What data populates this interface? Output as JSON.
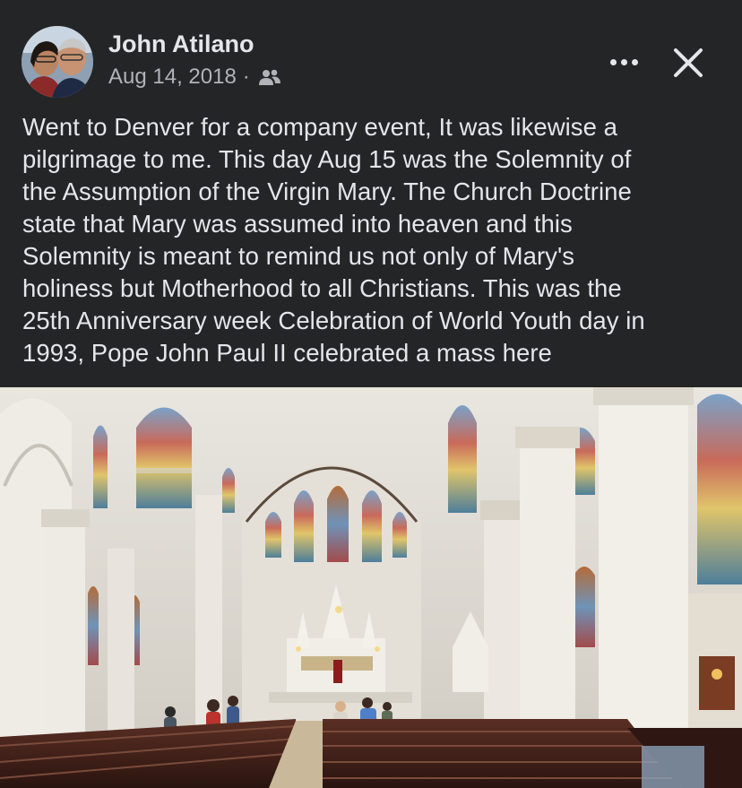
{
  "post": {
    "author": "John Atilano",
    "date": "Aug 14, 2018",
    "separator": "·",
    "audience_icon": "friends-icon",
    "more_icon": "more-dots-icon",
    "close_icon": "close-icon",
    "caption": "Went to Denver for a company event, It was likewise a\npilgrimage to me.  This day Aug 15 was the Solemnity of\nthe Assumption of the Virgin Mary. The Church Doctrine\nstate that Mary was assumed into heaven and this\nSolemnity is meant to remind us not only of Mary's\nholiness but Motherhood to all Christians.  This was the\n25th Anniversary week Celebration of World Youth day in\n1993,  Pope John Paul II celebrated a mass here"
  },
  "colors": {
    "background": "#242526",
    "primary_text": "#e4e6eb",
    "secondary_text": "#b0b3b8"
  }
}
